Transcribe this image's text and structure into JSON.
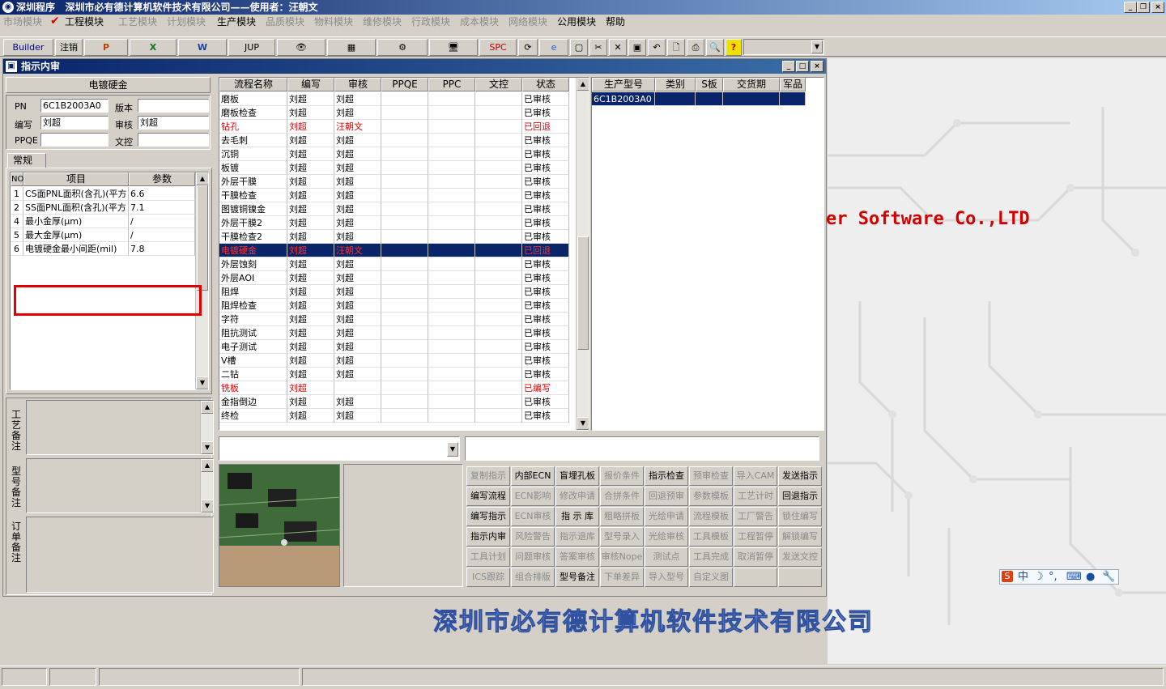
{
  "app": {
    "title": "深圳程序   深圳市必有德计算机软件技术有限公司——使用者：汪朝文"
  },
  "menu": [
    {
      "label": "市场模块",
      "enabled": false
    },
    {
      "label": "工程模块",
      "enabled": true
    },
    {
      "label": "工艺模块",
      "enabled": false
    },
    {
      "label": "计划模块",
      "enabled": false
    },
    {
      "label": "生产模块",
      "enabled": true
    },
    {
      "label": "品质模块",
      "enabled": false
    },
    {
      "label": "物料模块",
      "enabled": false
    },
    {
      "label": "维修模块",
      "enabled": false
    },
    {
      "label": "行政模块",
      "enabled": false
    },
    {
      "label": "成本模块",
      "enabled": false
    },
    {
      "label": "网络模块",
      "enabled": false
    },
    {
      "label": "公用模块",
      "enabled": true
    },
    {
      "label": "帮助",
      "enabled": true
    }
  ],
  "toolbar": {
    "builder": "Builder",
    "logout": "注销",
    "ppt": "P",
    "excel": "X",
    "word": "W",
    "jup": "JUP",
    "spc": "SPC",
    "help": "?"
  },
  "window": {
    "title": "指示内审"
  },
  "left": {
    "section_title": "电镀硬金",
    "pn_label": "PN",
    "pn_value": "6C1B2003A0",
    "version_label": "版本",
    "version_value": "",
    "author_label": "编写",
    "author_value": "刘超",
    "review_label": "审核",
    "review_value": "刘超",
    "ppqe_label": "PPQE",
    "ppqe_value": "",
    "control_label": "文控",
    "control_value": "",
    "tab": "常规",
    "param_headers": [
      "NO",
      "项目",
      "参数"
    ],
    "params": [
      {
        "no": "1",
        "item": "CS面PNL面积(含孔)(平方",
        "value": "6.6"
      },
      {
        "no": "2",
        "item": "SS面PNL面积(含孔)(平方",
        "value": "7.1"
      },
      {
        "no": "4",
        "item": "最小金厚(μm)",
        "value": "/"
      },
      {
        "no": "5",
        "item": "最大金厚(μm)",
        "value": "/"
      },
      {
        "no": "6",
        "item": "电镀硬金最小间距(mil)",
        "value": "7.8"
      }
    ],
    "note1": "工艺备注",
    "note2": "型号备注",
    "note3": "订单备注"
  },
  "process": {
    "headers": [
      "流程名称",
      "编写",
      "审核",
      "PPQE",
      "PPC",
      "文控",
      "状态"
    ],
    "rows": [
      {
        "name": "磨板",
        "w": "刘超",
        "r": "刘超",
        "s": "已审核",
        "st": ""
      },
      {
        "name": "磨板检查",
        "w": "刘超",
        "r": "刘超",
        "s": "已审核",
        "st": ""
      },
      {
        "name": "钻孔",
        "w": "刘超",
        "r": "汪朝文",
        "s": "已回退",
        "st": "red"
      },
      {
        "name": "去毛刺",
        "w": "刘超",
        "r": "刘超",
        "s": "已审核",
        "st": ""
      },
      {
        "name": "沉铜",
        "w": "刘超",
        "r": "刘超",
        "s": "已审核",
        "st": ""
      },
      {
        "name": "板镀",
        "w": "刘超",
        "r": "刘超",
        "s": "已审核",
        "st": ""
      },
      {
        "name": "外层干膜",
        "w": "刘超",
        "r": "刘超",
        "s": "已审核",
        "st": ""
      },
      {
        "name": "干膜检查",
        "w": "刘超",
        "r": "刘超",
        "s": "已审核",
        "st": ""
      },
      {
        "name": "图镀铜镍金",
        "w": "刘超",
        "r": "刘超",
        "s": "已审核",
        "st": ""
      },
      {
        "name": "外层干膜2",
        "w": "刘超",
        "r": "刘超",
        "s": "已审核",
        "st": ""
      },
      {
        "name": "干膜检查2",
        "w": "刘超",
        "r": "刘超",
        "s": "已审核",
        "st": ""
      },
      {
        "name": "电镀硬金",
        "w": "刘超",
        "r": "汪朝文",
        "s": "已回退",
        "st": "sel"
      },
      {
        "name": "外层蚀刻",
        "w": "刘超",
        "r": "刘超",
        "s": "已审核",
        "st": ""
      },
      {
        "name": "外层AOI",
        "w": "刘超",
        "r": "刘超",
        "s": "已审核",
        "st": ""
      },
      {
        "name": "阻焊",
        "w": "刘超",
        "r": "刘超",
        "s": "已审核",
        "st": ""
      },
      {
        "name": "阻焊检查",
        "w": "刘超",
        "r": "刘超",
        "s": "已审核",
        "st": ""
      },
      {
        "name": "字符",
        "w": "刘超",
        "r": "刘超",
        "s": "已审核",
        "st": ""
      },
      {
        "name": "阻抗测试",
        "w": "刘超",
        "r": "刘超",
        "s": "已审核",
        "st": ""
      },
      {
        "name": "电子测试",
        "w": "刘超",
        "r": "刘超",
        "s": "已审核",
        "st": ""
      },
      {
        "name": "V槽",
        "w": "刘超",
        "r": "刘超",
        "s": "已审核",
        "st": ""
      },
      {
        "name": "二钻",
        "w": "刘超",
        "r": "刘超",
        "s": "已审核",
        "st": ""
      },
      {
        "name": "铣板",
        "w": "刘超",
        "r": "",
        "s": "已编写",
        "st": "red"
      },
      {
        "name": "金指倒边",
        "w": "刘超",
        "r": "刘超",
        "s": "已审核",
        "st": ""
      },
      {
        "name": "终检",
        "w": "刘超",
        "r": "刘超",
        "s": "已审核",
        "st": ""
      }
    ]
  },
  "product": {
    "headers": [
      "生产型号",
      "类别",
      "S板",
      "交货期",
      "军品"
    ],
    "rows": [
      {
        "model": "6C1B2003A0"
      }
    ]
  },
  "actions": [
    [
      "复制指示",
      "内部ECN",
      "盲埋孔板",
      "报价条件",
      "指示检查",
      "预审检查",
      "导入CAM",
      "发送指示"
    ],
    [
      "编写流程",
      "ECN影响",
      "修改申请",
      "合拼条件",
      "回退预审",
      "参数模板",
      "工艺计时",
      "回退指示"
    ],
    [
      "编写指示",
      "ECN审核",
      "指 示 库",
      "粗略拼板",
      "光绘申请",
      "流程模板",
      "工厂警告",
      "锁住编写"
    ],
    [
      "指示内审",
      "风险警告",
      "指示退库",
      "型号录入",
      "光绘审核",
      "工具模板",
      "工程暂停",
      "解锁编写"
    ],
    [
      "工具计划",
      "问题审核",
      "答案审核",
      "审核Nope",
      "测试点",
      "工具完成",
      "取消暂停",
      "发送文控"
    ],
    [
      "ICS跟踪",
      "组合排版",
      "型号备注",
      "下单差异",
      "导入型号",
      "自定义图",
      "",
      ""
    ]
  ],
  "actions_enabled": [
    [
      false,
      true,
      true,
      false,
      true,
      false,
      false,
      true
    ],
    [
      true,
      false,
      false,
      false,
      false,
      false,
      false,
      true
    ],
    [
      true,
      false,
      true,
      false,
      false,
      false,
      false,
      false
    ],
    [
      true,
      false,
      false,
      false,
      false,
      false,
      false,
      false
    ],
    [
      false,
      false,
      false,
      false,
      false,
      false,
      false,
      false
    ],
    [
      false,
      false,
      true,
      false,
      false,
      false,
      false,
      false
    ]
  ],
  "background": {
    "brand_text": "er Software Co.,LTD",
    "company": "深圳市必有德计算机软件技术有限公司"
  },
  "ime": {
    "label": "中"
  }
}
